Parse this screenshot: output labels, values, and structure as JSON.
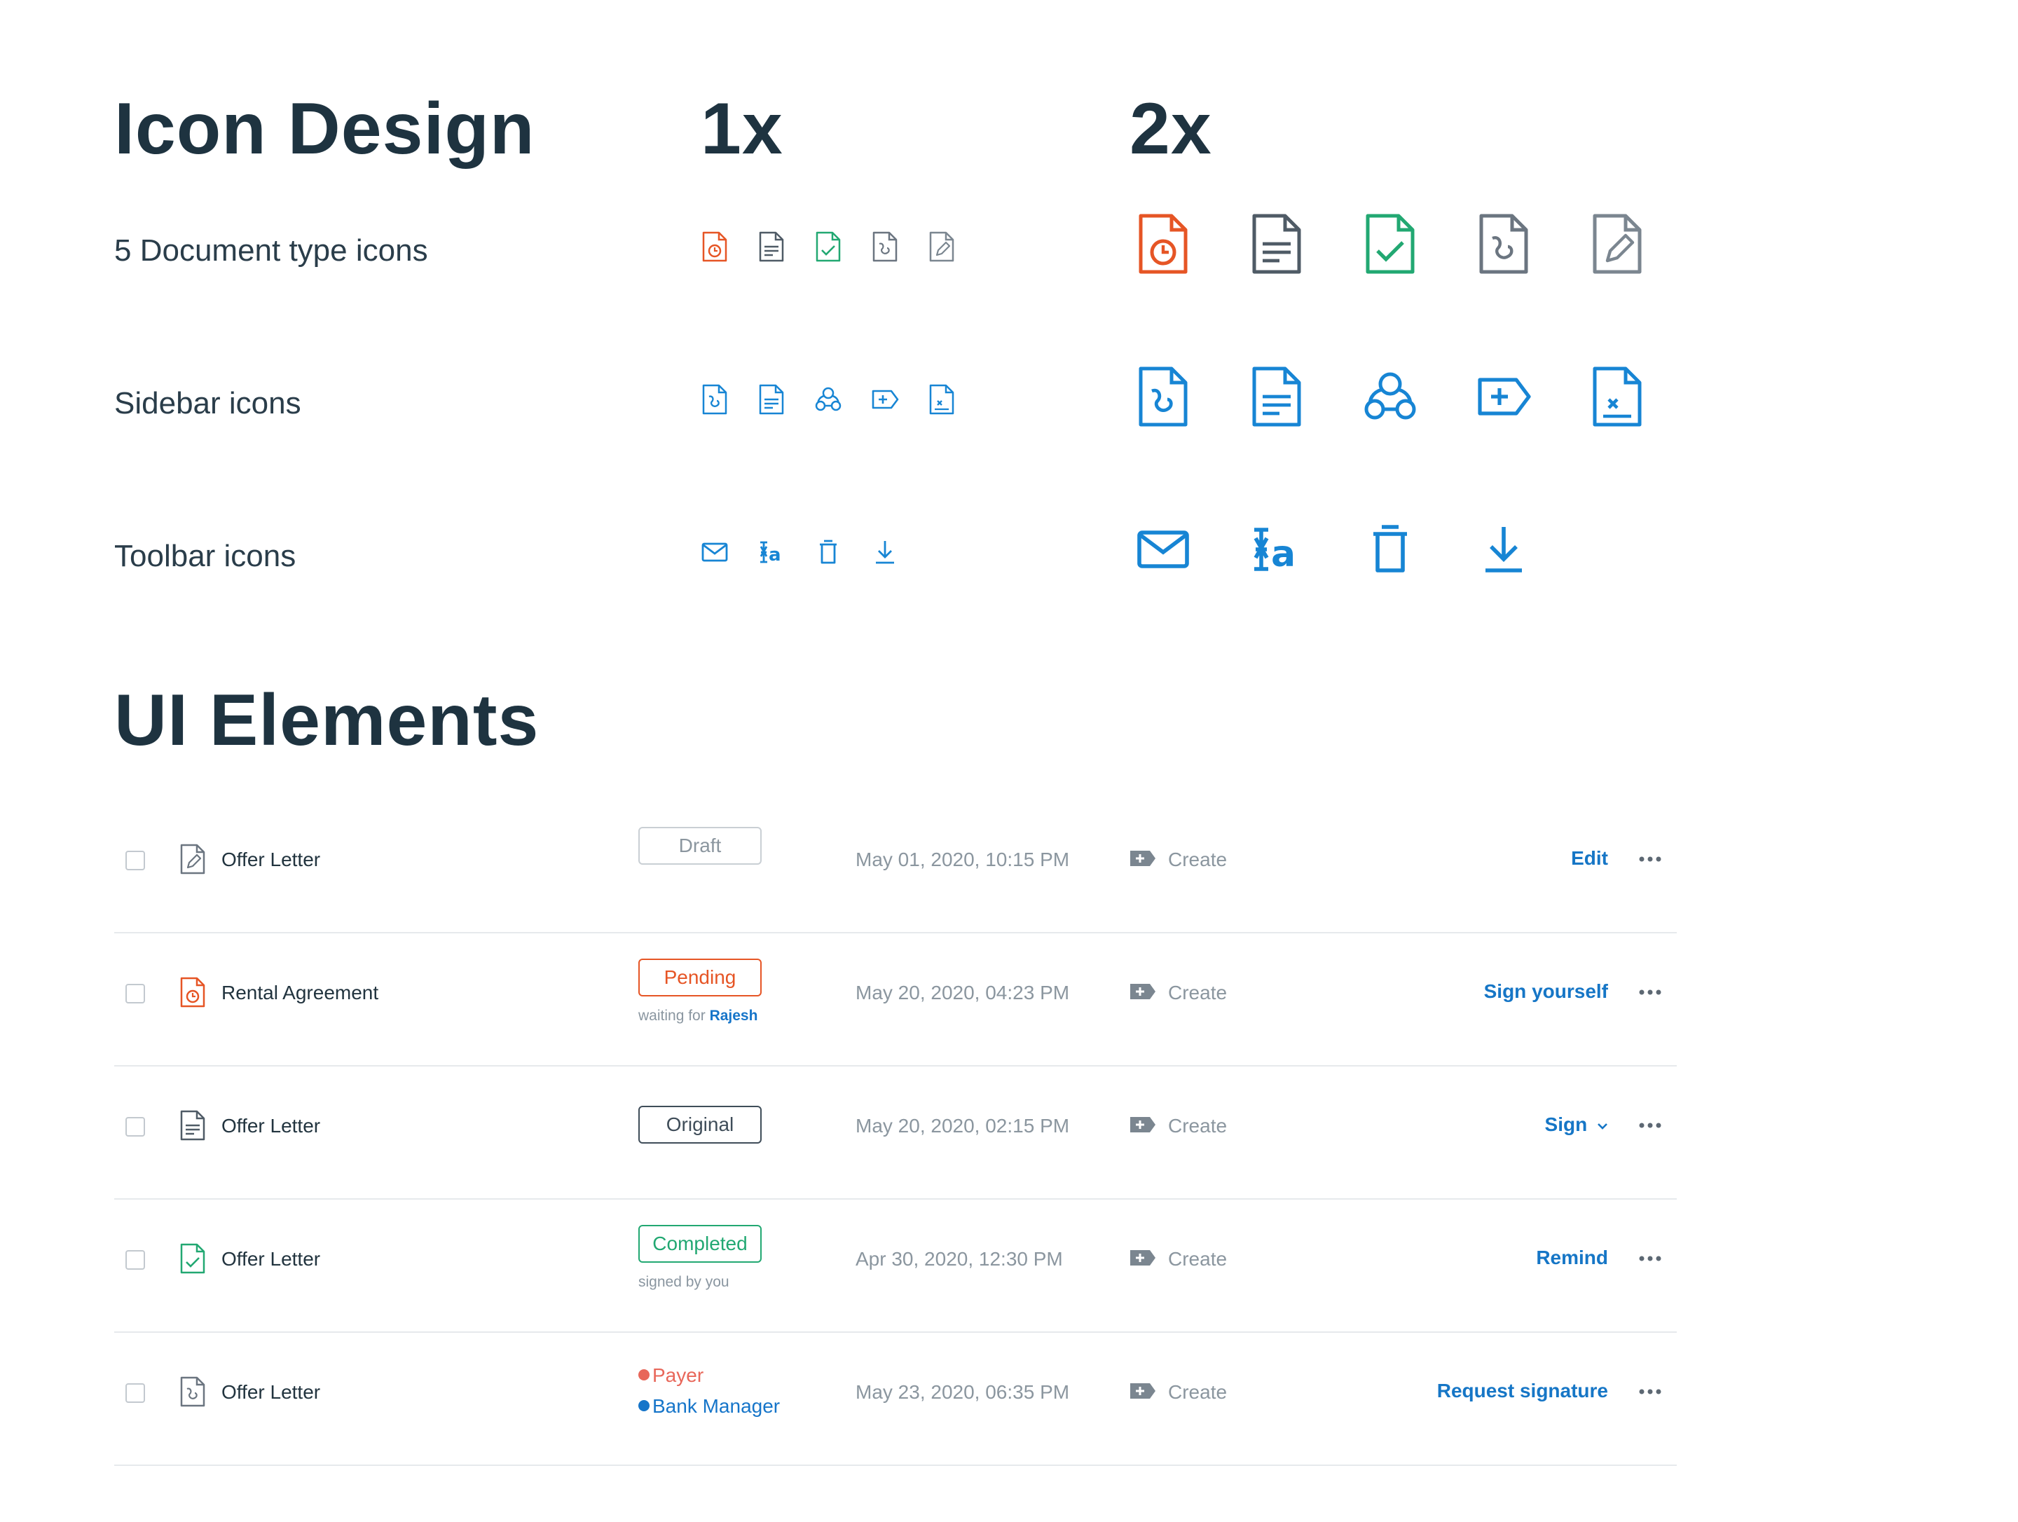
{
  "colors": {
    "orange": "#e65525",
    "gray": "#6b7580",
    "green": "#22a872",
    "blue": "#1785d4",
    "action_blue": "#1676c6",
    "payer_red": "#e8675a",
    "manager_blue": "#1675c9"
  },
  "icon_section": {
    "title": "Icon Design",
    "col_1x": "1x",
    "col_2x": "2x",
    "rows": [
      {
        "label": "5 Document type icons",
        "icons": [
          "doc-pending-icon",
          "doc-text-icon",
          "doc-completed-icon",
          "doc-signature-icon",
          "doc-draft-icon"
        ]
      },
      {
        "label": "Sidebar icons",
        "icons": [
          "signature-file-icon",
          "document-icon",
          "contacts-icon",
          "create-tag-icon",
          "template-icon"
        ]
      },
      {
        "label": "Toolbar icons",
        "icons": [
          "mail-icon",
          "text-field-icon",
          "trash-icon",
          "download-icon"
        ]
      }
    ]
  },
  "ui_section": {
    "title": "UI Elements",
    "rows": [
      {
        "icon": "doc-draft-icon",
        "name": "Offer Letter",
        "status": "Draft",
        "date": "May 01, 2020, 10:15 PM",
        "create": "Create",
        "action": "Edit"
      },
      {
        "icon": "doc-pending-icon",
        "name": "Rental Agreement",
        "status": "Pending",
        "sub_prefix": "waiting for",
        "sub_name": "Rajesh",
        "date": "May 20, 2020, 04:23 PM",
        "create": "Create",
        "action": "Sign yourself"
      },
      {
        "icon": "doc-text-icon",
        "name": "Offer Letter",
        "status": "Original",
        "date": "May 20, 2020, 02:15 PM",
        "create": "Create",
        "action": "Sign"
      },
      {
        "icon": "doc-completed-icon",
        "name": "Offer Letter",
        "status": "Completed",
        "sub_prefix": "signed by you",
        "date": "Apr 30, 2020, 12:30 PM",
        "create": "Create",
        "action": "Remind"
      },
      {
        "icon": "doc-signature-icon",
        "name": "Offer Letter",
        "legend": [
          "Payer",
          "Bank Manager"
        ],
        "date": "May 23, 2020, 06:35 PM",
        "create": "Create",
        "action": "Request signature"
      }
    ]
  }
}
